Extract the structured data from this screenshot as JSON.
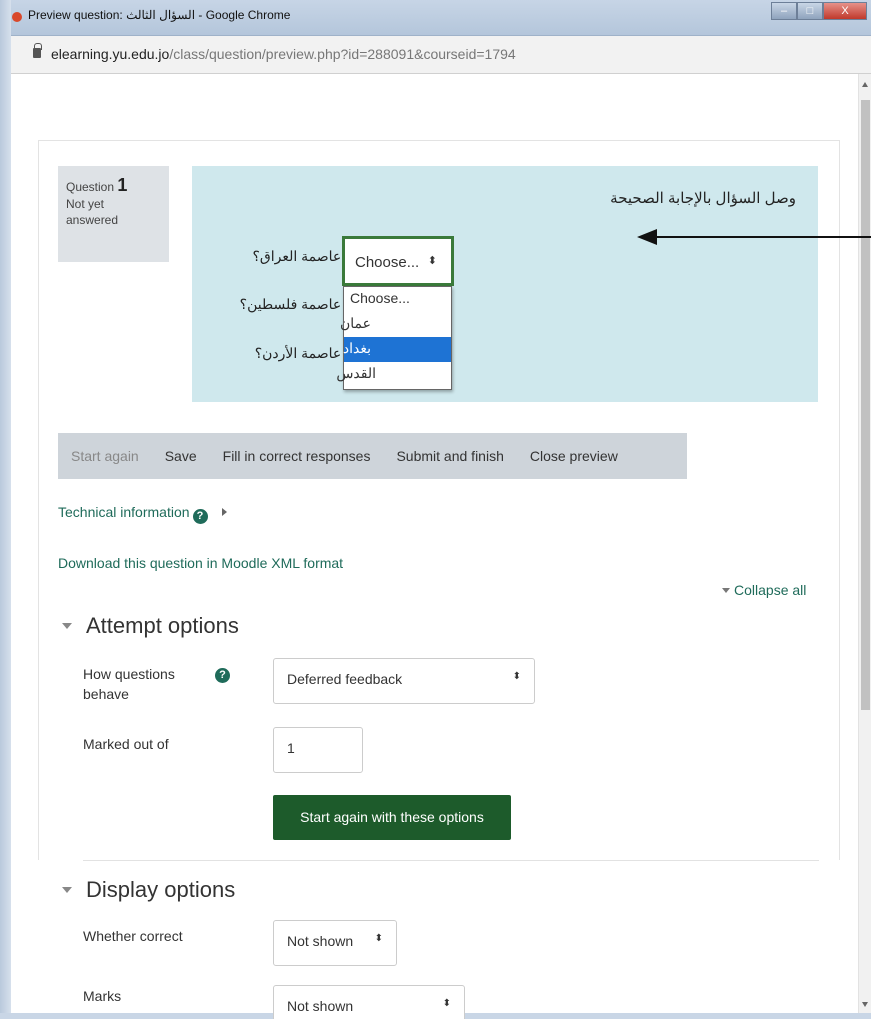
{
  "window": {
    "title": "Preview question: السؤال الثالث - Google Chrome",
    "buttons": [
      "–",
      "□",
      "X"
    ]
  },
  "address": {
    "host": "elearning.yu.edu.jo",
    "path": "/class/question/preview.php?id=288091&courseid=1794"
  },
  "question_info": {
    "label": "Question",
    "number": "1",
    "state": "Not yet answered"
  },
  "question": {
    "text": "وصل السؤال بالإجابة الصحيحة",
    "rows": [
      "ماهي عاصمة العراق؟",
      "ماهي عاصمة فلسطين؟",
      "ماهي عاصمة الأردن؟"
    ],
    "select_value": "Choose...",
    "dropdown_options": [
      "Choose...",
      "عمان",
      "بغداد",
      "القدس"
    ],
    "dropdown_selected_index": 2
  },
  "toolbar": {
    "start_again": "Start again",
    "save": "Save",
    "fill_correct": "Fill in correct responses",
    "submit_finish": "Submit and finish",
    "close_preview": "Close preview"
  },
  "links": {
    "technical_info": "Technical information",
    "download": "Download this question in Moodle XML format",
    "collapse_all": "Collapse all"
  },
  "attempt_options": {
    "title": "Attempt options",
    "behave_label": "How questions behave",
    "behave_value": "Deferred feedback",
    "marked_label": "Marked out of",
    "marked_value": "1",
    "start_again_button": "Start again with these options"
  },
  "display_options": {
    "title": "Display options",
    "correct_label": "Whether correct",
    "correct_value": "Not shown",
    "marks_label": "Marks",
    "marks_value": "Not shown"
  }
}
